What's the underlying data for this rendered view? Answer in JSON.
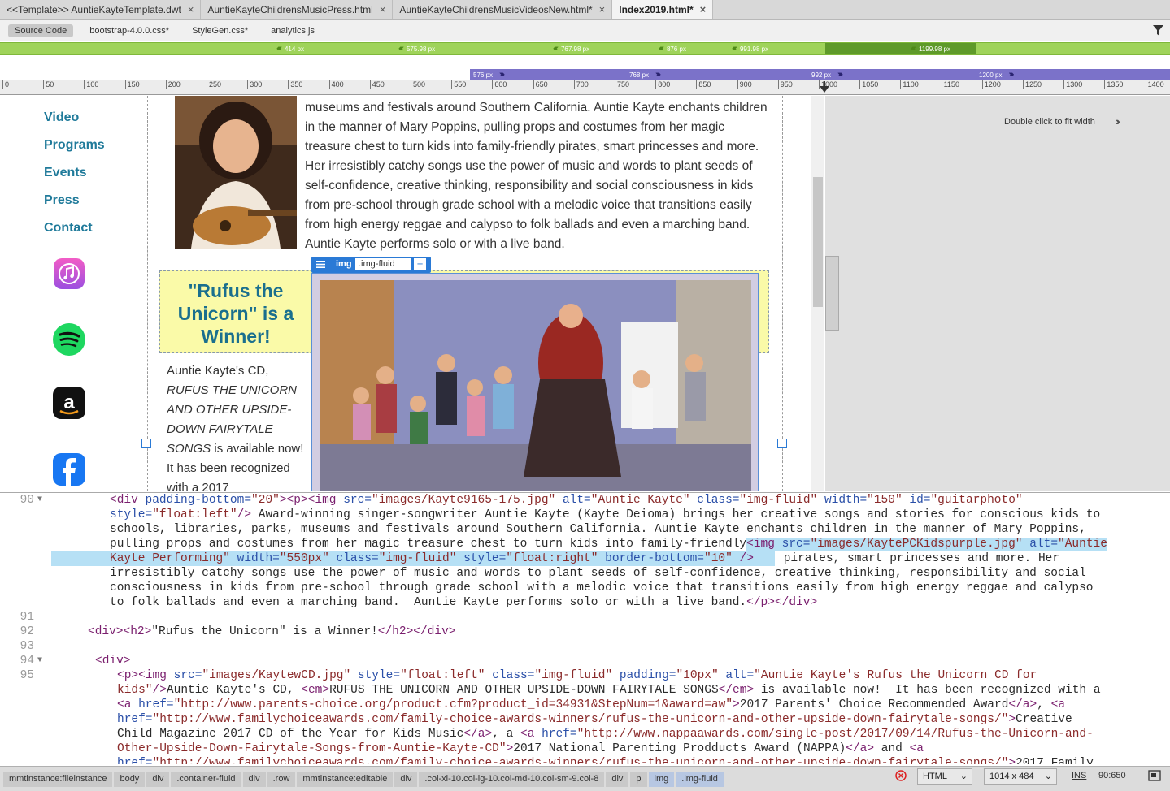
{
  "tabs": [
    {
      "label": "<<Template>> AuntieKayteTemplate.dwt",
      "active": false
    },
    {
      "label": "AuntieKayteChildrensMusicPress.html",
      "active": false
    },
    {
      "label": "AuntieKayteChildrensMusicVideosNew.html*",
      "active": false
    },
    {
      "label": "Index2019.html*",
      "active": true
    }
  ],
  "related_files": [
    "Source Code",
    "bootstrap-4.0.0.css*",
    "StyleGen.css*",
    "analytics.js"
  ],
  "media_queries_min": [
    "414 px",
    "575.98 px",
    "767.98 px",
    "876 px",
    "991.98 px",
    "1199.98 px"
  ],
  "media_queries_max": [
    "576 px",
    "768 px",
    "992 px",
    "1200 px"
  ],
  "ruler_ticks": [
    "0",
    "50",
    "100",
    "150",
    "200",
    "250",
    "300",
    "350",
    "400",
    "450",
    "500",
    "550",
    "600",
    "650",
    "700",
    "750",
    "800",
    "850",
    "900",
    "950",
    "1000",
    "1050",
    "1100",
    "1150",
    "1200",
    "1250",
    "1300",
    "1350",
    "1400"
  ],
  "fit_hint": "Double click to fit width",
  "nav": [
    "Video",
    "Programs",
    "Events",
    "Press",
    "Contact"
  ],
  "app_icons": [
    "itunes-icon",
    "spotify-icon",
    "amazon-icon",
    "facebook-icon"
  ],
  "bio_text": "museums and festivals around Southern California. Auntie Kayte enchants children in the manner of Mary Poppins, pulling props and costumes from her magic treasure chest to turn kids into family-friendly pirates, smart princesses and more. Her irresistibly catchy songs use the power of music and words to plant seeds of self-confidence, creative thinking, responsibility and social consciousness in kids from pre-school through grade school with a melodic voice that transitions easily from high energy reggae and calypso to folk ballads and even a marching band. Auntie Kayte performs solo or with a live band.",
  "winner_heading": "\"Rufus the Unicorn\" is a Winner!",
  "cd_text": {
    "before": "Auntie Kayte's CD,",
    "title": "RUFUS THE UNICORN AND OTHER UPSIDE-DOWN FAIRYTALE SONGS",
    "after": " is available now! It has been recognized with a 2017"
  },
  "img_toolbar": {
    "tag": "img",
    "class": ".img-fluid",
    "add": "+"
  },
  "code_lines": [
    {
      "num": "90",
      "fold": true
    },
    {
      "num": "91",
      "fold": false
    },
    {
      "num": "92",
      "fold": false
    },
    {
      "num": "93",
      "fold": false
    },
    {
      "num": "94",
      "fold": true
    },
    {
      "num": "95",
      "fold": false
    }
  ],
  "status_crumbs": [
    "mmtinstance:fileinstance",
    "body",
    "div",
    ".container-fluid",
    "div",
    ".row",
    "mmtinstance:editable",
    "div",
    ".col-xl-10.col-lg-10.col-md-10.col-sm-9.col-8",
    "div",
    "p",
    "img",
    ".img-fluid"
  ],
  "status": {
    "mode": "HTML",
    "size": "1014 x 484",
    "ins": "INS",
    "cursor": "90:650"
  }
}
